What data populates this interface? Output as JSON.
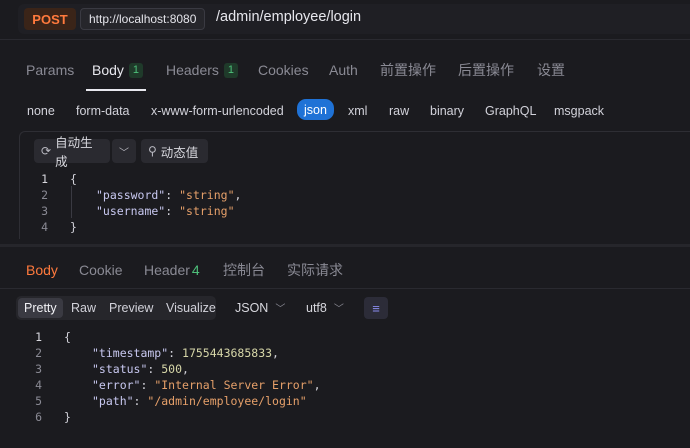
{
  "request": {
    "method": "POST",
    "host": "http://localhost:8080",
    "path": "/admin/employee/login"
  },
  "request_tabs": [
    {
      "label": "Params",
      "badge": ""
    },
    {
      "label": "Body",
      "badge": "1"
    },
    {
      "label": "Headers",
      "badge": "1"
    },
    {
      "label": "Cookies",
      "badge": ""
    },
    {
      "label": "Auth",
      "badge": ""
    },
    {
      "label": "前置操作",
      "badge": ""
    },
    {
      "label": "后置操作",
      "badge": ""
    },
    {
      "label": "设置",
      "badge": ""
    }
  ],
  "body_types": [
    "none",
    "form-data",
    "x-www-form-urlencoded",
    "json",
    "xml",
    "raw",
    "binary",
    "GraphQL",
    "msgpack"
  ],
  "active_body_type": "json",
  "toolbar": {
    "auto_generate": "自动生成",
    "dynamic_value": "动态值"
  },
  "request_body": {
    "line_numbers": [
      "1",
      "2",
      "3",
      "4"
    ],
    "open": "{",
    "close": "}",
    "fields": [
      {
        "key": "\"password\"",
        "value": "\"string\"",
        "comma": ","
      },
      {
        "key": "\"username\"",
        "value": "\"string\"",
        "comma": ""
      }
    ]
  },
  "response_tabs": [
    {
      "label": "Body",
      "badge": ""
    },
    {
      "label": "Cookie",
      "badge": ""
    },
    {
      "label": "Header",
      "badge": "4"
    },
    {
      "label": "控制台",
      "badge": ""
    },
    {
      "label": "实际请求",
      "badge": ""
    }
  ],
  "view_modes": [
    "Pretty",
    "Raw",
    "Preview",
    "Visualize"
  ],
  "format_select": "JSON",
  "encoding_select": "utf8",
  "response_body": {
    "line_numbers": [
      "1",
      "2",
      "3",
      "4",
      "5",
      "6"
    ],
    "open": "{",
    "close": "}",
    "fields": [
      {
        "key": "\"timestamp\"",
        "value": "1755443685833",
        "type": "num",
        "comma": ","
      },
      {
        "key": "\"status\"",
        "value": "500",
        "type": "num",
        "comma": ","
      },
      {
        "key": "\"error\"",
        "value": "\"Internal Server Error\"",
        "type": "str",
        "comma": ","
      },
      {
        "key": "\"path\"",
        "value": "\"/admin/employee/login\"",
        "type": "str",
        "comma": ""
      }
    ]
  },
  "colors": {
    "accent_orange": "#ff7a3d",
    "active_pill_blue": "#1f72d6",
    "badge_green": "#4ec07a"
  }
}
